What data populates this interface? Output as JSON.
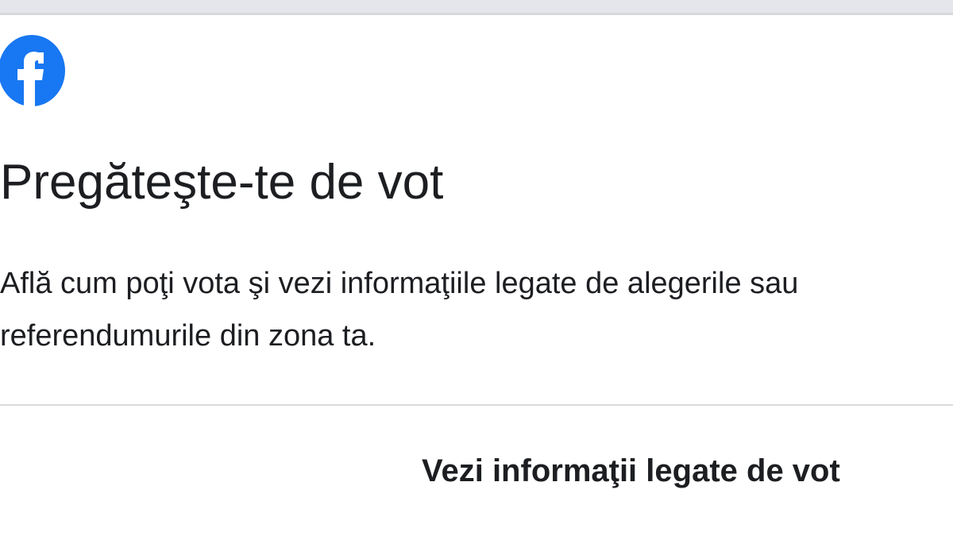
{
  "header": {
    "logo_icon": "facebook-logo-icon",
    "brand_color": "#1877f2"
  },
  "card": {
    "title": "Pregăteşte-te de vot",
    "description": "Află cum poţi vota şi vezi informaţiile legate de alegerile sau referendumurile din zona ta.",
    "action_label": "Vezi informaţii legate de vot"
  },
  "colors": {
    "text": "#1c1e21",
    "background": "#ffffff",
    "divider": "#d9dadd",
    "top_strip": "#e4e6eb"
  }
}
